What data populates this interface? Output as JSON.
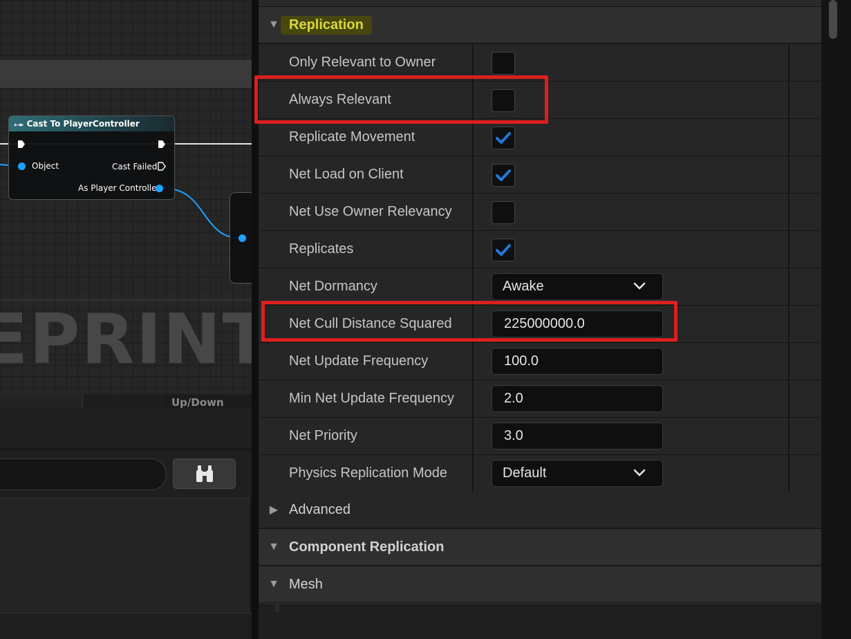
{
  "graph": {
    "node_title": "Cast To PlayerController",
    "pin_object": "Object",
    "pin_cast_failed": "Cast Failed",
    "pin_as_player_controller": "As Player Controller",
    "watermark": "EPRINT",
    "updown_label": "Up/Down"
  },
  "details": {
    "section_replication": "Replication",
    "rows": [
      {
        "name": "Only Relevant to Owner",
        "type": "checkbox",
        "checked": false
      },
      {
        "name": "Always Relevant",
        "type": "checkbox",
        "checked": false
      },
      {
        "name": "Replicate Movement",
        "type": "checkbox",
        "checked": true
      },
      {
        "name": "Net Load on Client",
        "type": "checkbox",
        "checked": true
      },
      {
        "name": "Net Use Owner Relevancy",
        "type": "checkbox",
        "checked": false
      },
      {
        "name": "Replicates",
        "type": "checkbox",
        "checked": true
      },
      {
        "name": "Net Dormancy",
        "type": "combo",
        "value": "Awake"
      },
      {
        "name": "Net Cull Distance Squared",
        "type": "number",
        "value": "225000000.0"
      },
      {
        "name": "Net Update Frequency",
        "type": "number",
        "value": "100.0"
      },
      {
        "name": "Min Net Update Frequency",
        "type": "number",
        "value": "2.0"
      },
      {
        "name": "Net Priority",
        "type": "number",
        "value": "3.0"
      },
      {
        "name": "Physics Replication Mode",
        "type": "combo",
        "value": "Default"
      }
    ],
    "section_advanced": "Advanced",
    "section_component_replication": "Component Replication",
    "section_mesh": "Mesh"
  },
  "colors": {
    "checkmark": "#1e7bd8",
    "highlight_text": "#d8d83a",
    "annotation_red": "#dd1f1f",
    "data_pin": "#1ea2ff"
  },
  "icons": {
    "find_button": "binoculars-icon",
    "expanded": "triangle-down-icon",
    "collapsed": "triangle-right-icon",
    "dropdown": "chevron-down-icon"
  }
}
